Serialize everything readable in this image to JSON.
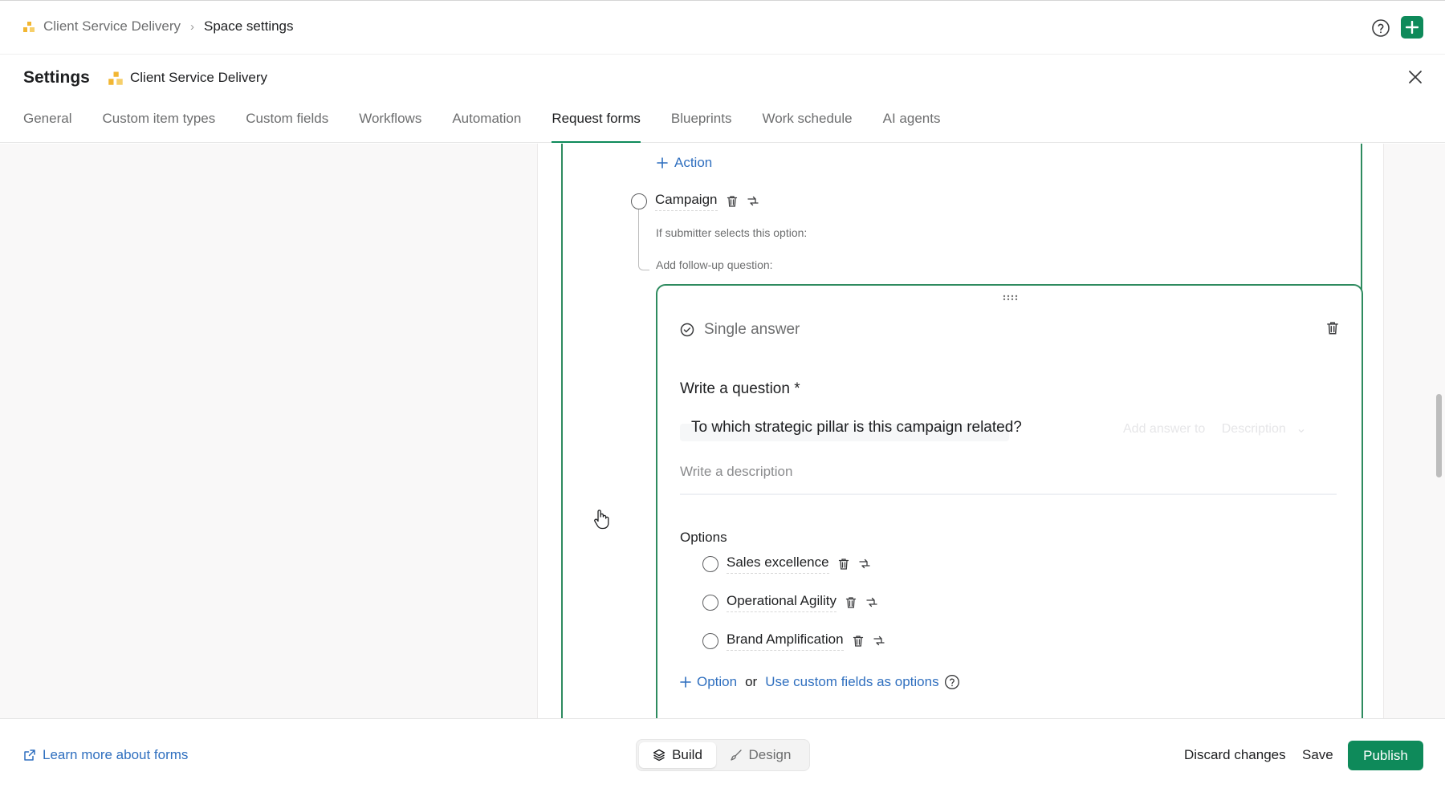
{
  "breadcrumb": {
    "space": "Client Service Delivery",
    "current": "Space settings"
  },
  "settings": {
    "title": "Settings",
    "space_name": "Client Service Delivery"
  },
  "tabs": [
    {
      "label": "General"
    },
    {
      "label": "Custom item types"
    },
    {
      "label": "Custom fields"
    },
    {
      "label": "Workflows"
    },
    {
      "label": "Automation"
    },
    {
      "label": "Request forms",
      "active": true
    },
    {
      "label": "Blueprints"
    },
    {
      "label": "Work schedule"
    },
    {
      "label": "AI agents"
    }
  ],
  "form": {
    "action_label": "Action",
    "option": {
      "label": "Campaign",
      "if_selects": "If submitter selects this option:",
      "add_followup": "Add follow-up question:"
    },
    "followup": {
      "type_label": "Single answer",
      "question_label": "Write a question *",
      "question_value": "To which strategic pillar is this campaign related?",
      "answer_to_label": "Add answer to",
      "answer_to_value": "Description",
      "description_placeholder": "Write a description",
      "options_label": "Options",
      "options": [
        {
          "label": "Sales excellence"
        },
        {
          "label": "Operational Agility"
        },
        {
          "label": "Brand Amplification"
        }
      ],
      "add_option_label": "Option",
      "or_text": "or",
      "custom_fields_link": "Use custom fields as options"
    }
  },
  "footer": {
    "learn_more": "Learn more about forms",
    "build_label": "Build",
    "design_label": "Design",
    "discard_label": "Discard changes",
    "save_label": "Save",
    "publish_label": "Publish"
  },
  "colors": {
    "accent": "#0e8a5a",
    "link": "#2f6fbf",
    "border_active": "#2e8b5f"
  }
}
